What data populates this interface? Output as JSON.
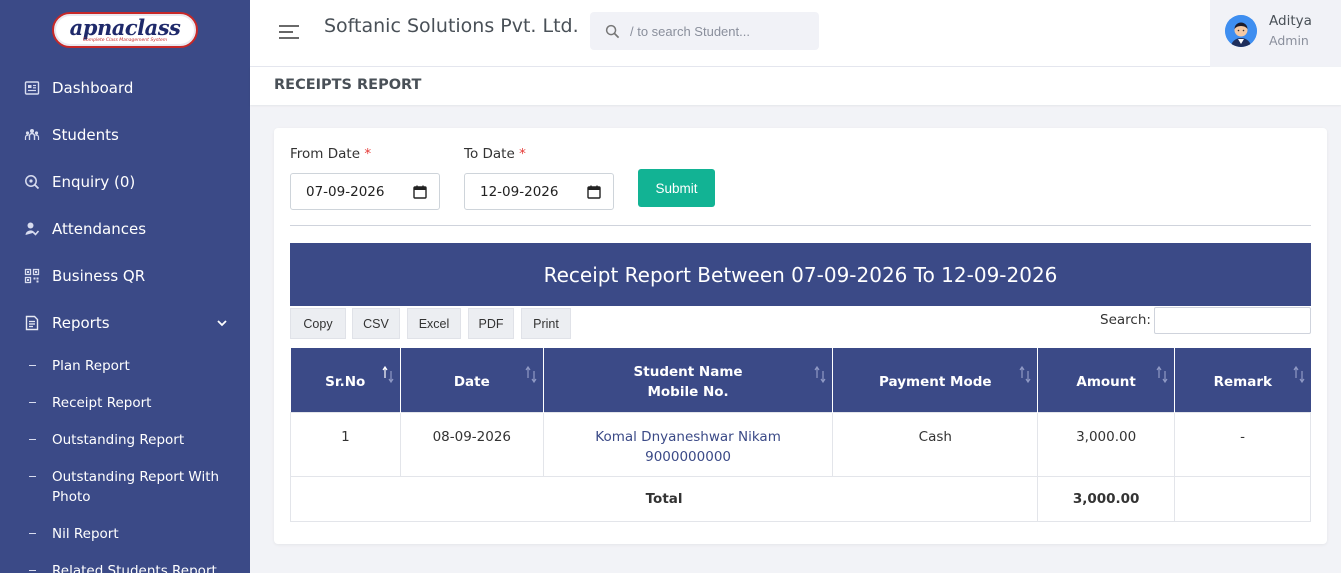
{
  "brand": {
    "logo_text": "apnaclass",
    "logo_tagline": "Complete Class Management System"
  },
  "sidebar": {
    "items": [
      {
        "label": "Dashboard",
        "icon": "dashboard-icon"
      },
      {
        "label": "Students",
        "icon": "students-icon"
      },
      {
        "label": "Enquiry (0)",
        "icon": "enquiry-icon"
      },
      {
        "label": "Attendances",
        "icon": "attendance-icon"
      },
      {
        "label": "Business QR",
        "icon": "qr-icon"
      },
      {
        "label": "Reports",
        "icon": "reports-icon",
        "expanded": true
      }
    ],
    "sub_items": [
      {
        "label": "Plan Report"
      },
      {
        "label": "Receipt Report"
      },
      {
        "label": "Outstanding Report"
      },
      {
        "label": "Outstanding Report With Photo"
      },
      {
        "label": "Nil Report"
      },
      {
        "label": "Related Students Report"
      }
    ]
  },
  "header": {
    "company": "Softanic Solutions Pvt. Ltd.",
    "search_placeholder": "/ to search Student...",
    "user_name": "Aditya",
    "user_role": "Admin"
  },
  "page": {
    "title": "RECEIPTS REPORT"
  },
  "filters": {
    "from_label": "From Date",
    "to_label": "To Date",
    "required_mark": "*",
    "from_value": "07-09-2026",
    "to_value": "12-09-2026",
    "submit_label": "Submit"
  },
  "report": {
    "banner": "Receipt Report Between 07-09-2026 To 12-09-2026",
    "buttons": {
      "copy": "Copy",
      "csv": "CSV",
      "excel": "Excel",
      "pdf": "PDF",
      "print": "Print"
    },
    "search_label": "Search:",
    "columns": {
      "srno": "Sr.No",
      "date": "Date",
      "student_name": "Student Name",
      "mobile": "Mobile No.",
      "payment_mode": "Payment Mode",
      "amount": "Amount",
      "remark": "Remark"
    },
    "rows": [
      {
        "srno": "1",
        "date": "08-09-2026",
        "student_name": "Komal Dnyaneshwar Nikam",
        "mobile": "9000000000",
        "payment_mode": "Cash",
        "amount": "3,000.00",
        "remark": "-"
      }
    ],
    "total_label": "Total",
    "total_amount": "3,000.00"
  },
  "colors": {
    "sidebar": "#3b4a87",
    "accent": "#12b394",
    "table_header": "#3b4a87"
  }
}
